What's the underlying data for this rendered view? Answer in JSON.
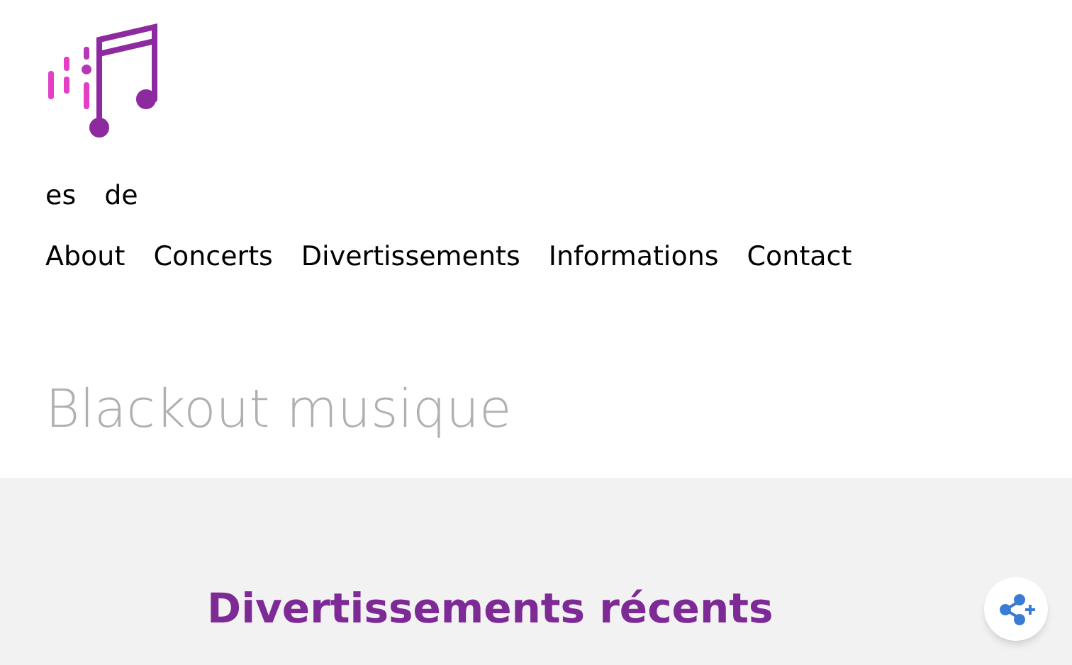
{
  "languages": [
    {
      "label": "es"
    },
    {
      "label": "de"
    }
  ],
  "nav": [
    {
      "label": "About"
    },
    {
      "label": "Concerts"
    },
    {
      "label": "Divertissements"
    },
    {
      "label": "Informations"
    },
    {
      "label": "Contact"
    }
  ],
  "site_title": "Blackout musique",
  "section": {
    "heading": "Divertissements récents"
  }
}
